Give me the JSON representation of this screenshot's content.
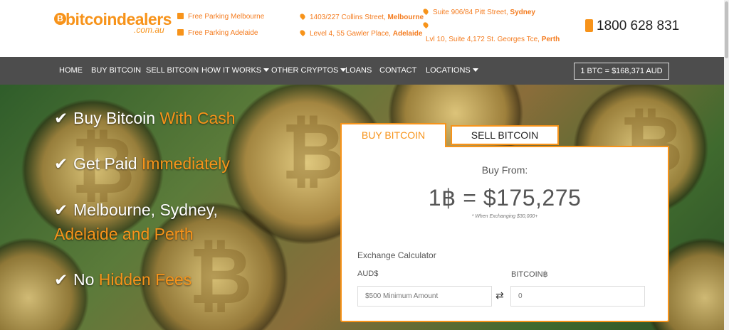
{
  "header": {
    "logo": {
      "coin_glyph": "B",
      "word_a": "bitcoin",
      "word_b": "dealers",
      "sub": ".com.au"
    },
    "parking": [
      {
        "label": "Free Parking Melbourne"
      },
      {
        "label": "Free Parking Adelaide"
      }
    ],
    "addresses": [
      {
        "street": "1403/227 Collins Street,",
        "city": "Melbourne"
      },
      {
        "street": "Level 4, 55 Gawler Place,",
        "city": "Adelaide"
      },
      {
        "street": "Suite 906/84 Pitt Street,",
        "city": "Sydney"
      },
      {
        "street": "Lvl 10, Suite 4,172 St. Georges Tce,",
        "city": "Perth"
      }
    ],
    "phone": "1800 628 831"
  },
  "nav": {
    "items": [
      {
        "label": "HOME",
        "dropdown": false
      },
      {
        "label": "BUY BITCOIN",
        "dropdown": false
      },
      {
        "label": "SELL BITCOIN",
        "dropdown": false
      },
      {
        "label": "HOW IT WORKS",
        "dropdown": true
      },
      {
        "label": "OTHER CRYPTOS",
        "dropdown": true
      },
      {
        "label": "LOANS",
        "dropdown": false
      },
      {
        "label": "CONTACT",
        "dropdown": false
      },
      {
        "label": "LOCATIONS",
        "dropdown": true
      }
    ],
    "btc_rate": "1 BTC = $168,371 AUD"
  },
  "hero": {
    "features": [
      {
        "text": "Buy Bitcoin",
        "accent": "With Cash"
      },
      {
        "text": "Get Paid",
        "accent": "Immediately"
      },
      {
        "text": "Melbourne, Sydney,",
        "accent": "",
        "line2": "Adelaide and Perth"
      },
      {
        "text": "No",
        "accent": "Hidden Fees"
      }
    ]
  },
  "widget": {
    "tabs": {
      "buy": "BUY BITCOIN",
      "sell": "SELL BITCOIN"
    },
    "buy_from": "Buy From:",
    "price": "1฿ = $175,275",
    "note": "* When Exchanging $30,000+",
    "calc_title": "Exchange Calculator",
    "aud_label": "AUD$",
    "btc_label": "BITCOIN฿",
    "aud_placeholder": "$500 Minimum Amount",
    "btc_value": "0",
    "swap_glyph": "⇄"
  },
  "colors": {
    "accent": "#f7931a",
    "nav_bg": "#4d4d4d",
    "text": "#555555"
  }
}
